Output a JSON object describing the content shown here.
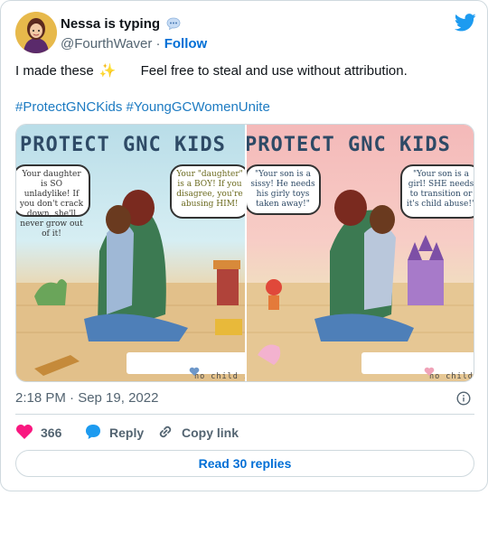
{
  "author": {
    "display_name": "Nessa is typing",
    "status_emoji": "speech-bubble-icon",
    "handle": "@FourthWaver",
    "separator": "·",
    "follow_label": "Follow"
  },
  "tweet": {
    "text_before": "I made these",
    "sparkle": "✨",
    "text_after": "Feel free to steal and use without attribution.",
    "hashtags": "#ProtectGNCKids #YoungGCWomenUnite",
    "timestamp": "2:18 PM · Sep 19, 2022"
  },
  "media": {
    "left": {
      "title": "PROTECT GNC KIDS",
      "bubble_left": "Your daughter is SO unladylike! If you don't crack down, she'll never grow out of it!",
      "bubble_right": "Your \"daughter\" is a BOY! If you disagree, you're abusing HIM!",
      "banner": "no child is born\nin the wrong body"
    },
    "right": {
      "title": "PROTECT GNC KIDS",
      "bubble_left": "\"Your son is a sissy! He needs his girly toys taken away!\"",
      "bubble_right": "\"Your son is a girl! SHE needs to transition or it's child abuse!\"",
      "banner": "no child is born\nin the wrong body"
    }
  },
  "actions": {
    "likes_count": "366",
    "reply_label": "Reply",
    "copy_label": "Copy link",
    "read_replies_label": "Read 30 replies"
  },
  "colors": {
    "link": "#006fd6",
    "hashtag": "#1d7bc2",
    "heart": "#f91880",
    "reply_icon": "#1d9bf0",
    "twitter_blue": "#1d9bf0"
  }
}
